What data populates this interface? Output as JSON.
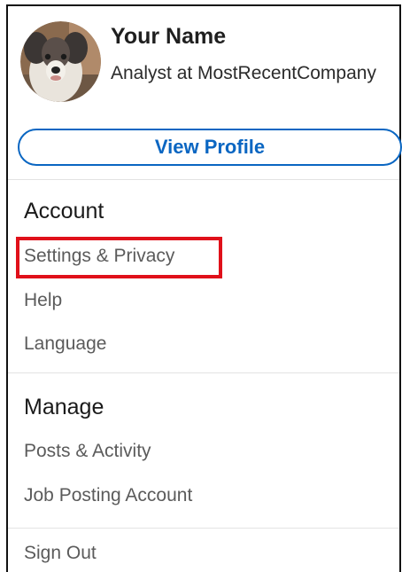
{
  "profile": {
    "name": "Your Name",
    "headline": "Analyst at MostRecentCompany",
    "view_profile_label": "View Profile"
  },
  "account": {
    "title": "Account",
    "items": [
      {
        "label": "Settings & Privacy"
      },
      {
        "label": "Help"
      },
      {
        "label": "Language"
      }
    ]
  },
  "manage": {
    "title": "Manage",
    "items": [
      {
        "label": "Posts & Activity"
      },
      {
        "label": "Job Posting Account"
      }
    ]
  },
  "sign_out_label": "Sign Out",
  "colors": {
    "accent": "#0a66c2",
    "highlight": "#e0101a"
  }
}
